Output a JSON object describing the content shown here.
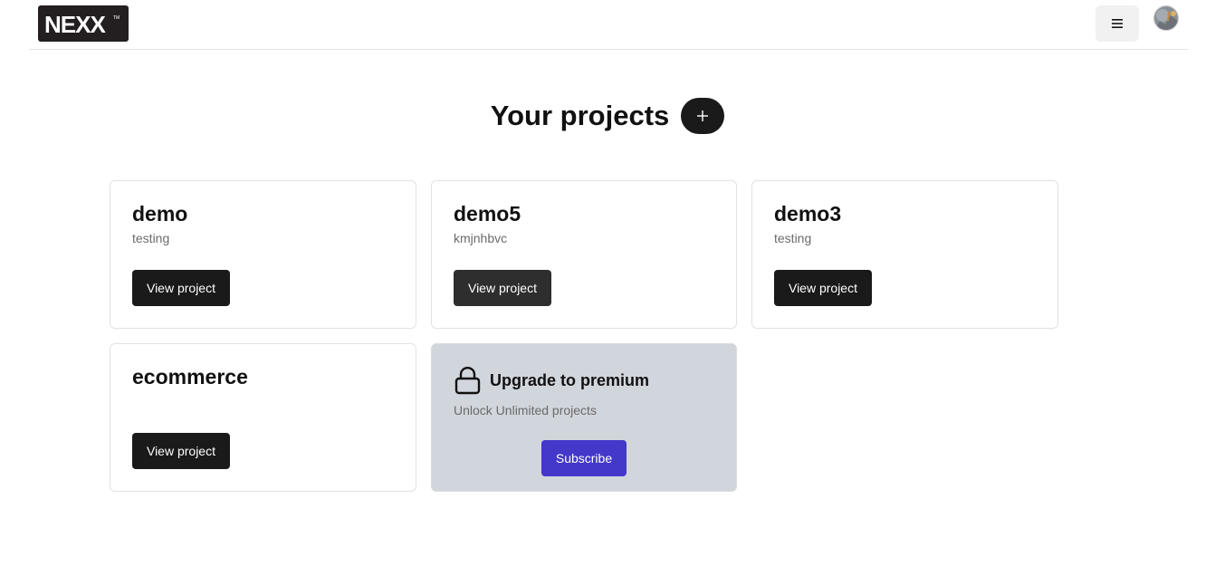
{
  "header": {
    "logo_text": "NEXX",
    "logo_mark": "TM",
    "menu_icon": "hamburger-menu-icon",
    "avatar_icon": "user-avatar"
  },
  "main": {
    "title": "Your projects",
    "add_icon": "plus-icon"
  },
  "projects": [
    {
      "name": "demo",
      "description": "testing",
      "button_label": "View project"
    },
    {
      "name": "demo5",
      "description": "kmjnhbvc",
      "button_label": "View project"
    },
    {
      "name": "demo3",
      "description": "testing",
      "button_label": "View project"
    },
    {
      "name": "ecommerce",
      "description": "",
      "button_label": "View project"
    }
  ],
  "premium": {
    "icon": "lock-icon",
    "title": "Upgrade to premium",
    "description": "Unlock Unlimited projects",
    "button_label": "Subscribe"
  },
  "colors": {
    "primary_button": "#1a1a1a",
    "subscribe_button": "#4338ca",
    "premium_card_bg": "#d1d5dc",
    "logo_bg": "#231f20"
  }
}
